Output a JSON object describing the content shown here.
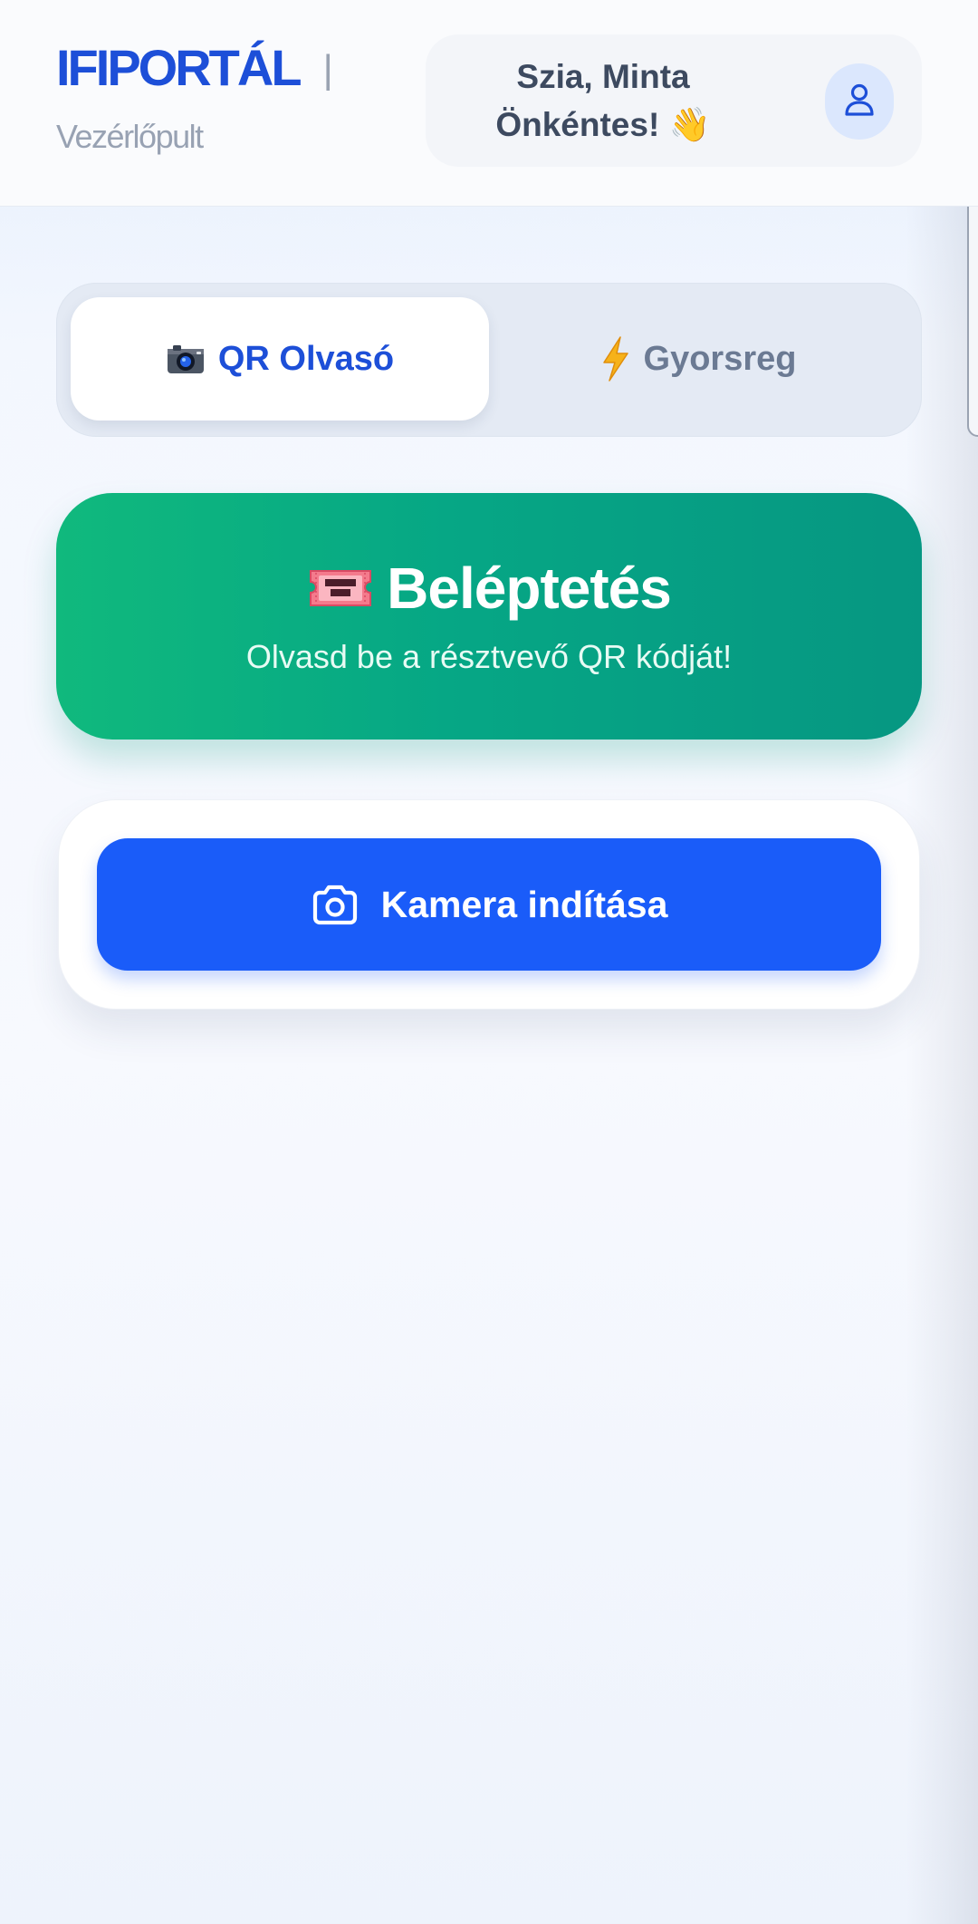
{
  "header": {
    "brand": "IFIPORTÁL",
    "separator": "|",
    "subtitle": "Vezérlőpult",
    "greeting_line1": "Szia, Minta",
    "greeting_line2": "Önkéntes! 👋",
    "avatar_icon": "user-icon"
  },
  "tabs": [
    {
      "icon": "camera-icon",
      "glyph": "📷",
      "label": "QR Olvasó",
      "active": true
    },
    {
      "icon": "lightning-icon",
      "glyph": "⚡",
      "label": "Gyorsreg",
      "active": false
    }
  ],
  "banner": {
    "icon": "ticket-icon",
    "title": "Beléptetés",
    "subtitle": "Olvasd be a résztvevő QR kódját!"
  },
  "camera": {
    "icon": "camera-icon",
    "button_label": "Kamera indítása"
  },
  "colors": {
    "brand": "#1d4fd8",
    "banner_start": "#10b97d",
    "banner_end": "#069782",
    "primary_button": "#1a5cf9"
  }
}
